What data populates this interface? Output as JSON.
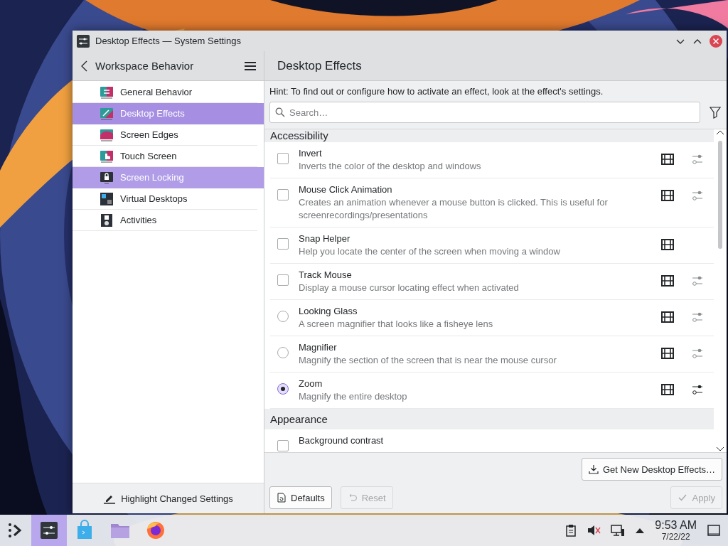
{
  "window": {
    "title": "Desktop Effects — System Settings"
  },
  "sidebar": {
    "title": "Workspace Behavior",
    "items": [
      {
        "label": "General Behavior",
        "selected": false,
        "hovered": false
      },
      {
        "label": "Desktop Effects",
        "selected": true,
        "hovered": false
      },
      {
        "label": "Screen Edges",
        "selected": false,
        "hovered": false
      },
      {
        "label": "Touch Screen",
        "selected": false,
        "hovered": false
      },
      {
        "label": "Screen Locking",
        "selected": false,
        "hovered": true
      },
      {
        "label": "Virtual Desktops",
        "selected": false,
        "hovered": false
      },
      {
        "label": "Activities",
        "selected": false,
        "hovered": false
      }
    ],
    "footer": "Highlight Changed Settings"
  },
  "page": {
    "title": "Desktop Effects",
    "hint": "Hint: To find out or configure how to activate an effect, look at the effect's settings.",
    "search": {
      "placeholder": "Search…"
    }
  },
  "effects": [
    {
      "kind": "header",
      "label": "Accessibility"
    },
    {
      "kind": "checkbox",
      "name": "Invert",
      "description": "Inverts the color of the desktop and windows",
      "checked": false,
      "video": true,
      "configurable": true,
      "config_active": false
    },
    {
      "kind": "checkbox",
      "name": "Mouse Click Animation",
      "description": "Creates an animation whenever a mouse button is clicked. This is useful for screenrecordings/presentations",
      "checked": false,
      "video": true,
      "configurable": true,
      "config_active": false
    },
    {
      "kind": "checkbox",
      "name": "Snap Helper",
      "description": "Help you locate the center of the screen when moving a window",
      "checked": false,
      "video": true,
      "configurable": false
    },
    {
      "kind": "checkbox",
      "name": "Track Mouse",
      "description": "Display a mouse cursor locating effect when activated",
      "checked": false,
      "video": true,
      "configurable": true,
      "config_active": false
    },
    {
      "kind": "radio",
      "name": "Looking Glass",
      "description": "A screen magnifier that looks like a fisheye lens",
      "checked": false,
      "video": true,
      "configurable": true,
      "config_active": false
    },
    {
      "kind": "radio",
      "name": "Magnifier",
      "description": "Magnify the section of the screen that is near the mouse cursor",
      "checked": false,
      "video": true,
      "configurable": true,
      "config_active": false
    },
    {
      "kind": "radio",
      "name": "Zoom",
      "description": "Magnify the entire desktop",
      "checked": true,
      "video": true,
      "configurable": true,
      "config_active": true
    },
    {
      "kind": "header",
      "label": "Appearance"
    },
    {
      "kind": "checkbox",
      "name": "Background contrast",
      "checked": false,
      "video": false,
      "configurable": false
    }
  ],
  "buttons": {
    "get_new": "Get New Desktop Effects…",
    "defaults": {
      "label": "Defaults",
      "disabled": false
    },
    "reset": {
      "label": "Reset",
      "disabled": true
    },
    "apply": {
      "label": "Apply",
      "disabled": true
    }
  },
  "taskbar": {
    "tasks": [
      {
        "active": true
      },
      {
        "active": false
      },
      {
        "active": false
      },
      {
        "active": false
      }
    ],
    "time": "9:53 AM",
    "date": "7/22/22"
  }
}
